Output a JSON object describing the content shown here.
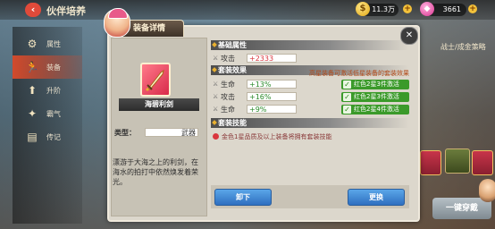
{
  "topbar": {
    "title": "伙伴培养",
    "coins": "11.3万",
    "gems": "3661"
  },
  "sidenav": {
    "items": [
      {
        "label": "属性"
      },
      {
        "label": "装备"
      },
      {
        "label": "升阶"
      },
      {
        "label": "霸气"
      },
      {
        "label": "传记"
      }
    ]
  },
  "right_scene": {
    "label": "战士/成金策略",
    "one_click_button": "一键穿戴"
  },
  "dialog": {
    "title": "装备详情",
    "item": {
      "name": "海碧利剑",
      "type_label": "类型：",
      "type_value": "武器",
      "description": "漂游于大海之上的利剑，在海水的拍打中依然焕发着荣光。"
    },
    "basic_attr": {
      "heading": "基础属性",
      "stats": [
        {
          "name": "攻击",
          "value": "+2333"
        }
      ]
    },
    "set_effect": {
      "heading": "套装效果",
      "note": "高星装备可激活低星装备的套装效果",
      "stats": [
        {
          "name": "生命",
          "value": "+13%"
        },
        {
          "name": "攻击",
          "value": "+16%"
        },
        {
          "name": "生命",
          "value": "+9%"
        }
      ],
      "tags": [
        {
          "label": "红色2星3件激活"
        },
        {
          "label": "红色2星3件激活"
        },
        {
          "label": "红色2星4件激活"
        }
      ]
    },
    "set_skill": {
      "heading": "套装技能",
      "text": "金色1星品质及以上装备将拥有套装技能"
    },
    "buttons": {
      "unequip": "卸下",
      "replace": "更换"
    }
  }
}
